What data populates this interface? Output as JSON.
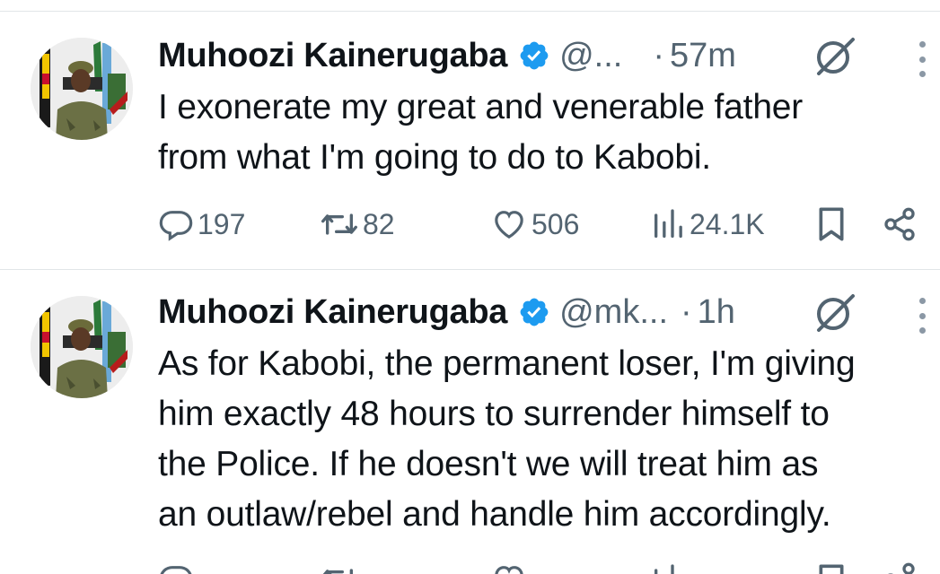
{
  "tweets": [
    {
      "author": "Muhoozi Kainerugaba",
      "handle": "@...",
      "separator": "·",
      "time": "57m",
      "text_lines": [
        "I exonerate my great and venerable father",
        "from what I'm going to do to Kabobi."
      ],
      "metrics": {
        "replies": "197",
        "reposts": "82",
        "likes": "506",
        "views": "24.1K"
      }
    },
    {
      "author": "Muhoozi Kainerugaba",
      "handle": "@mk...",
      "separator": "·",
      "time": "1h",
      "text_lines": [
        "As for Kabobi, the permanent loser, I'm giving",
        "him exactly 48 hours to surrender himself to",
        "the Police. If he doesn't we will treat him as",
        "an outlaw/rebel and handle him accordingly."
      ]
    }
  ],
  "icons": {
    "verified": "verified-badge-icon",
    "grok": "grok-icon",
    "more": "more-icon",
    "reply": "reply-icon",
    "repost": "repost-icon",
    "like": "like-icon",
    "views": "views-icon",
    "bookmark": "bookmark-icon",
    "share": "share-icon"
  },
  "colors": {
    "verified_blue": "#1d9bf0",
    "secondary_text": "#536471",
    "primary_text": "#0f1419"
  }
}
